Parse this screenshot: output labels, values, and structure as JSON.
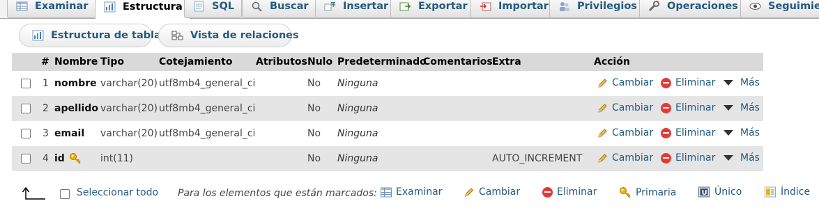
{
  "tabs": [
    {
      "label": "Examinar",
      "icon": "table-browse-icon"
    },
    {
      "label": "Estructura",
      "icon": "structure-icon",
      "active": true
    },
    {
      "label": "SQL",
      "icon": "sql-icon"
    },
    {
      "label": "Buscar",
      "icon": "search-icon"
    },
    {
      "label": "Insertar",
      "icon": "insert-icon"
    },
    {
      "label": "Exportar",
      "icon": "export-icon"
    },
    {
      "label": "Importar",
      "icon": "import-icon"
    },
    {
      "label": "Privilegios",
      "icon": "privileges-icon"
    },
    {
      "label": "Operaciones",
      "icon": "wrench-icon"
    },
    {
      "label": "Seguimiento",
      "icon": "eye-icon"
    }
  ],
  "subnav": {
    "table_structure": "Estructura de tabla",
    "relation_view": "Vista de relaciones"
  },
  "columns": {
    "num": "#",
    "name": "Nombre",
    "type": "Tipo",
    "collation": "Cotejamiento",
    "attributes": "Atributos",
    "null": "Nulo",
    "default": "Predeterminado",
    "comments": "Comentarios",
    "extra": "Extra",
    "action": "Acción"
  },
  "rows": [
    {
      "num": "1",
      "name": "nombre",
      "type": "varchar(20)",
      "collation": "utf8mb4_general_ci",
      "null": "No",
      "default": "Ninguna",
      "extra": ""
    },
    {
      "num": "2",
      "name": "apellido",
      "type": "varchar(20)",
      "collation": "utf8mb4_general_ci",
      "null": "No",
      "default": "Ninguna",
      "extra": ""
    },
    {
      "num": "3",
      "name": "email",
      "type": "varchar(20)",
      "collation": "utf8mb4_general_ci",
      "null": "No",
      "default": "Ninguna",
      "extra": ""
    },
    {
      "num": "4",
      "name": "id",
      "type": "int(11)",
      "collation": "",
      "null": "No",
      "default": "Ninguna",
      "extra": "AUTO_INCREMENT",
      "primary_key": true
    }
  ],
  "actions": {
    "change": "Cambiar",
    "drop": "Eliminar",
    "more": "Más"
  },
  "bottom": {
    "select_all": "Seleccionar todo",
    "with_selected": "Para los elementos que están marcados:",
    "browse": "Examinar",
    "change": "Cambiar",
    "drop": "Eliminar",
    "primary": "Primaria",
    "unique": "Único",
    "index": "Índice"
  },
  "colors": {
    "link": "#235a81",
    "header_bg": "#d9d9d9",
    "row_even": "#e5e5e5",
    "drop_red": "#e53935",
    "key_gold": "#f0b400"
  }
}
